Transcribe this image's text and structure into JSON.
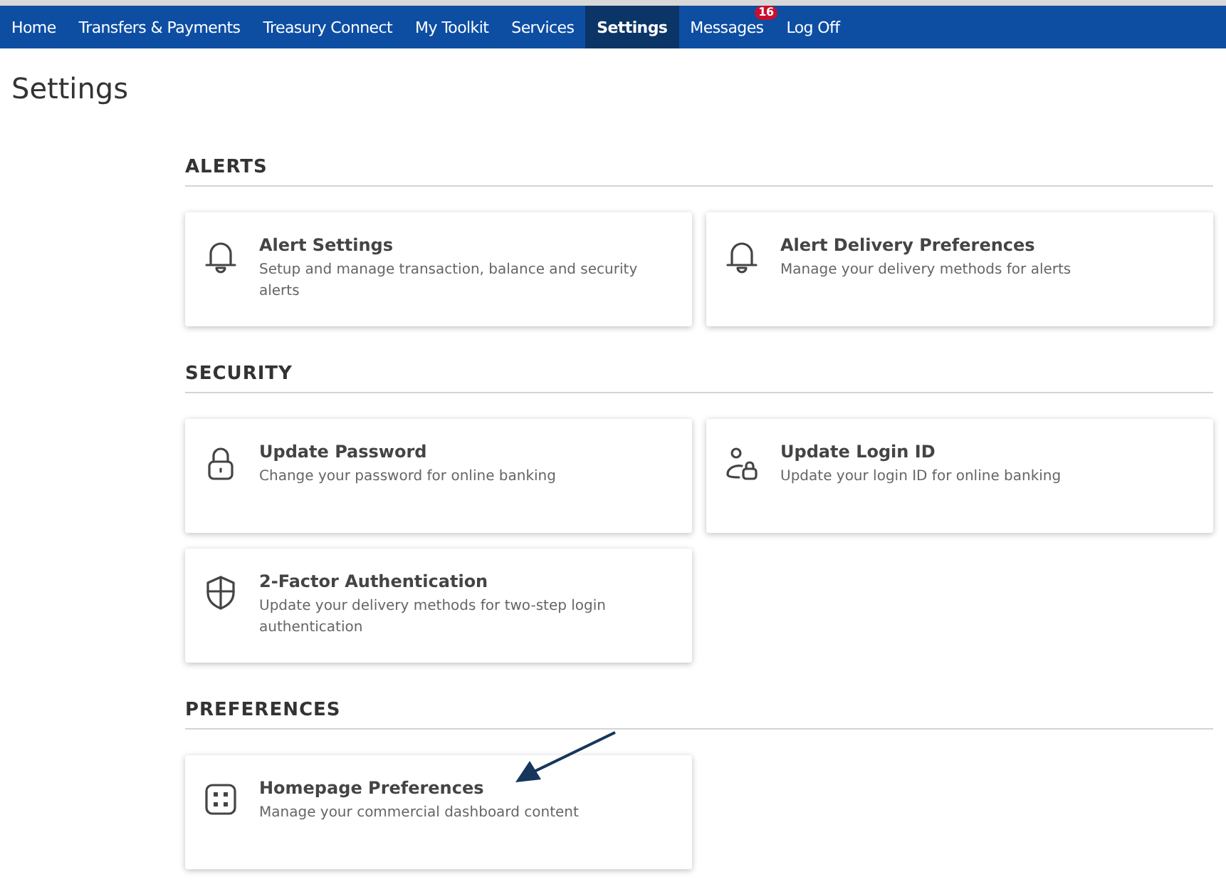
{
  "nav": [
    {
      "label": "Home",
      "selected": false
    },
    {
      "label": "Transfers & Payments",
      "selected": false
    },
    {
      "label": "Treasury Connect",
      "selected": false
    },
    {
      "label": "My Toolkit",
      "selected": false
    },
    {
      "label": "Services",
      "selected": false
    },
    {
      "label": "Settings",
      "selected": true
    },
    {
      "label": "Messages",
      "selected": false,
      "badge": "16"
    },
    {
      "label": "Log Off",
      "selected": false
    }
  ],
  "page_title": "Settings",
  "sections": [
    {
      "heading": "ALERTS",
      "cards": [
        {
          "kind": "bell",
          "title": "Alert Settings",
          "description": "Setup and manage transaction, balance and security alerts"
        },
        {
          "kind": "bell",
          "title": "Alert Delivery Preferences",
          "description": "Manage your delivery methods for alerts"
        }
      ]
    },
    {
      "heading": "SECURITY",
      "cards": [
        {
          "kind": "lock",
          "title": "Update Password",
          "description": "Change your password for online banking"
        },
        {
          "kind": "user-lock",
          "title": "Update Login ID",
          "description": "Update your login ID for online banking"
        },
        {
          "kind": "shield",
          "title": "2-Factor Authentication",
          "description": "Update your delivery methods for two-step login authentication"
        }
      ]
    },
    {
      "heading": "PREFERENCES",
      "cards": [
        {
          "kind": "grid",
          "title": "Homepage Preferences",
          "description": "Manage your commercial dashboard content"
        }
      ]
    }
  ]
}
